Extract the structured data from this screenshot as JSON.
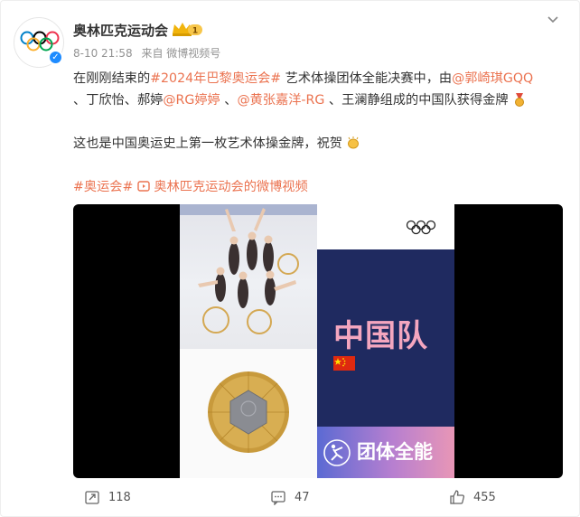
{
  "post": {
    "author_name": "奥林匹克运动会",
    "vip_level": "1",
    "meta_time": "8-10 21:58",
    "meta_source": "来自 微博视频号",
    "content": {
      "p1_prefix": "在刚刚结束的",
      "p1_hashtag": "#2024年巴黎奥运会#",
      "p1_mid": " 艺术体操团体全能决赛中，由",
      "p1_mention1": "@郭崎琪GQQ",
      "p1_sep1": "、丁欣怡、郝婷",
      "p1_mention2": "@RG婷婷",
      "p1_sep2": " 、",
      "p1_mention3": "@黄张嘉洋-RG",
      "p1_suffix": " 、王澜静组成的中国队获得金牌",
      "p2": "这也是中国奥运史上第一枚艺术体操金牌，祝贺",
      "tag_hashtag": "#奥运会#",
      "tag_video_link": "奥林匹克运动会的微博视频"
    },
    "video": {
      "team_text": "中国队",
      "event_text": "团体全能"
    },
    "actions": {
      "repost_count": "118",
      "comment_count": "47",
      "like_count": "455"
    }
  },
  "colors": {
    "link": "#eb7350",
    "verified": "#1e8bff",
    "navy": "#1f2a60",
    "team_text": "#f4a6bf"
  },
  "icons": [
    "olympic-rings-icon",
    "verified-icon",
    "vip-crown-icon",
    "more-chevron-icon",
    "video-link-icon",
    "medal-icon",
    "clap-icon",
    "repost-icon",
    "comment-icon",
    "like-icon"
  ]
}
